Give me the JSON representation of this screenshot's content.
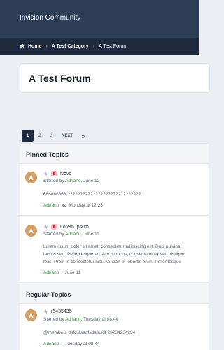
{
  "header": {
    "site_title": "Invision Community"
  },
  "breadcrumb": {
    "home": "Home",
    "category": "A Test Category",
    "current": "A Test Forum"
  },
  "page": {
    "title": "A Test Forum"
  },
  "pagination": {
    "pages": [
      "1",
      "2",
      "3"
    ],
    "current": "1",
    "next": "NEXT",
    "last": "»"
  },
  "pinned": {
    "heading": "Pinned Topics",
    "topics": [
      {
        "avatar": "A",
        "title": "Novo",
        "started_prefix": "Started by ",
        "author": "Adriano",
        "date": ", June 12",
        "snippet": "666666666 ?????????????????????????????",
        "last_author": "Adriano",
        "last_time": "Monday at 12:23"
      },
      {
        "avatar": "A",
        "title": "Lorem Ipsum",
        "started_prefix": "Started by ",
        "author": "Adriano",
        "date": ", June 11",
        "snippet_lines": [
          "Lorem ipsum dolor sit amet, consectetur adipiscing elit. Duis pulvinar",
          "iaculis sed. Pellentesque ac sem rhoncus, consectetur ex vel, tristique",
          "felis. Proin in consectetur nisi. Aenean et lobortis enim. Pellentesque"
        ],
        "last_author": "Adriano",
        "last_time": "June 11"
      }
    ]
  },
  "regular": {
    "heading": "Regular Topics",
    "topics": [
      {
        "avatar": "A",
        "title": "r5435435",
        "started_prefix": "Started by ",
        "author": "Adriano",
        "date": ", Tuesday at 08:44",
        "snippet": "@members dsfdsfsadfsdafasdf 23234234234",
        "last_author": "Adriano",
        "last_time": "Tuesday at 08:44"
      }
    ]
  },
  "colors": {
    "header": "#2c3e56",
    "breadcrumb": "#1e2a3d",
    "author_link": "#3a8a3a",
    "avatar": "#d4a06a"
  }
}
